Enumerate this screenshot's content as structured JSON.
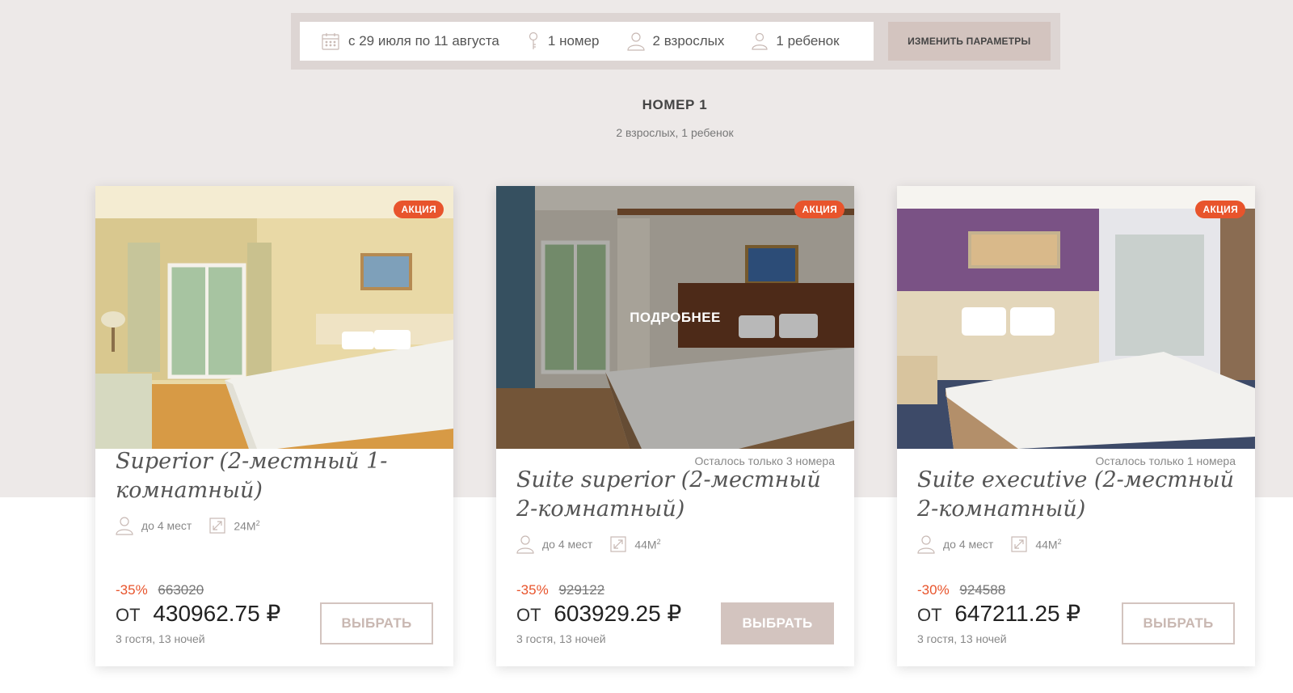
{
  "search": {
    "dates": "с 29 июля по 11 августа",
    "rooms": "1 номер",
    "adults": "2 взрослых",
    "children": "1 ребенок",
    "change_button": "ИЗМЕНИТЬ ПАРАМЕТРЫ"
  },
  "room_section": {
    "title": "НОМЕР 1",
    "subtitle": "2 взрослых, 1 ребенок"
  },
  "cards": [
    {
      "badge": "АКЦИЯ",
      "remaining": "",
      "name": "Superior (2-местный 1-комнатный)",
      "capacity": "до 4 мест",
      "area": "24М",
      "area_sup": "2",
      "discount": "-35%",
      "old_price": "663020",
      "price_prefix": "ОТ",
      "price": "430962.75 ₽",
      "guests": "3 гостя, 13 ночей",
      "button": "ВЫБРАТЬ"
    },
    {
      "badge": "АКЦИЯ",
      "hover_label": "ПОДРОБНЕЕ",
      "remaining": "Осталось только 3 номера",
      "name": "Suite superior (2-местный 2-комнатный)",
      "capacity": "до 4 мест",
      "area": "44М",
      "area_sup": "2",
      "discount": "-35%",
      "old_price": "929122",
      "price_prefix": "ОТ",
      "price": "603929.25 ₽",
      "guests": "3 гостя, 13 ночей",
      "button": "ВЫБРАТЬ"
    },
    {
      "badge": "АКЦИЯ",
      "remaining": "Осталось только 1 номера",
      "name": "Suite executive (2-местный 2-комнатный)",
      "capacity": "до 4 мест",
      "area": "44М",
      "area_sup": "2",
      "discount": "-30%",
      "old_price": "924588",
      "price_prefix": "ОТ",
      "price": "647211.25 ₽",
      "guests": "3 гостя, 13 ночей",
      "button": "ВЫБРАТЬ"
    }
  ],
  "colors": {
    "accent": "#d3c4bf",
    "badge": "#e8542c",
    "background": "#ede9e8"
  }
}
